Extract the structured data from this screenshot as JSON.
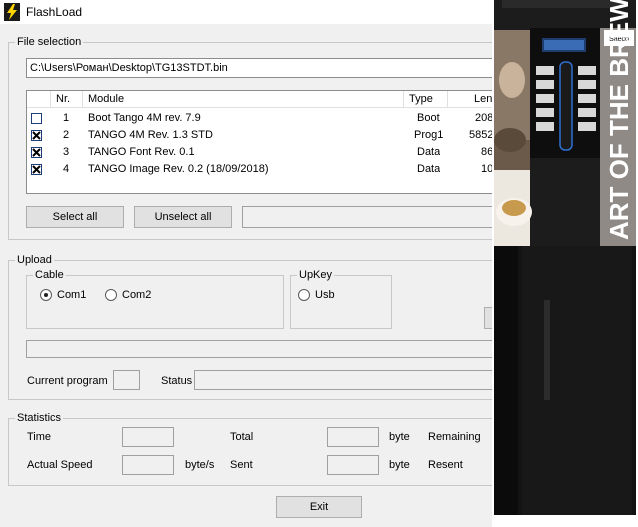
{
  "window": {
    "title": "FlashLoad"
  },
  "file_selection": {
    "legend": "File selection",
    "path": "C:\\Users\\Роман\\Desktop\\TG13STDT.bin",
    "columns": [
      "Nr.",
      "Module",
      "Type",
      "Leng"
    ],
    "rows": [
      {
        "nr": "1",
        "module": "Boot Tango 4M rev. 7.9",
        "type": "Boot",
        "length": "208",
        "checked": false
      },
      {
        "nr": "2",
        "module": "TANGO 4M Rev. 1.3 STD",
        "type": "Prog1",
        "length": "5852",
        "checked": true
      },
      {
        "nr": "3",
        "module": "TANGO Font Rev. 0.1",
        "type": "Data",
        "length": "86",
        "checked": true
      },
      {
        "nr": "4",
        "module": "TANGO Image Rev. 0.2  (18/09/2018)",
        "type": "Data",
        "length": "10",
        "checked": true
      }
    ],
    "select_all": "Select all",
    "unselect_all": "Unselect all"
  },
  "upload": {
    "legend": "Upload",
    "cable_legend": "Cable",
    "com1": "Com1",
    "com2": "Com2",
    "selected": "Com1",
    "upkey_legend": "UpKey",
    "usb": "Usb",
    "current_program_label": "Current program",
    "status_label": "Status"
  },
  "statistics": {
    "legend": "Statistics",
    "time_label": "Time",
    "total_label": "Total",
    "byte_label_1": "byte",
    "remaining_label": "Remaining",
    "actual_speed_label": "Actual Speed",
    "bytes_label": "byte/s",
    "sent_label": "Sent",
    "byte_label_2": "byte",
    "resent_label": "Resent"
  },
  "exit_label": "Exit",
  "machine_image": {
    "brand_text": "ART OF THE BREW",
    "badge": "Saeco"
  },
  "colors": {
    "accent": "#0078d7",
    "window_bg": "#f0f0f0",
    "machine_body": "#1c1c1c"
  }
}
